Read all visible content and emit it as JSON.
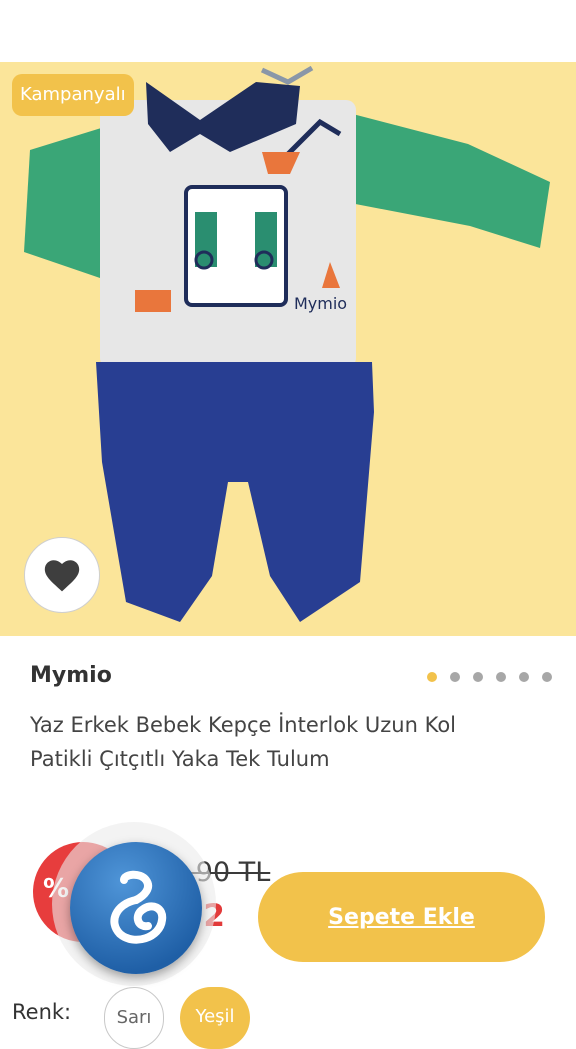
{
  "product": {
    "badge": "Kampanyalı",
    "brand": "Mymio",
    "title_line1": "Yaz Erkek Bebek Kepçe İnterlok Uzun Kol",
    "title_line2": "Patikli Çıtçıtlı Yaka Tek Tulum",
    "old_price": "2,90 TL",
    "new_price": ",92",
    "discount_symbol": "%",
    "garment_print": "Mymio",
    "image_count": 6,
    "active_image": 1
  },
  "actions": {
    "add_to_cart": "Sepete Ekle",
    "favorite_icon": "heart-icon"
  },
  "colors": {
    "label": "Renk:",
    "options": [
      "Sarı",
      "Yeşil"
    ],
    "selected": "Yeşil"
  },
  "theme": {
    "accent": "#f2c24b",
    "price_red": "#e23a3a",
    "hero_bg": "#fbe59a"
  }
}
